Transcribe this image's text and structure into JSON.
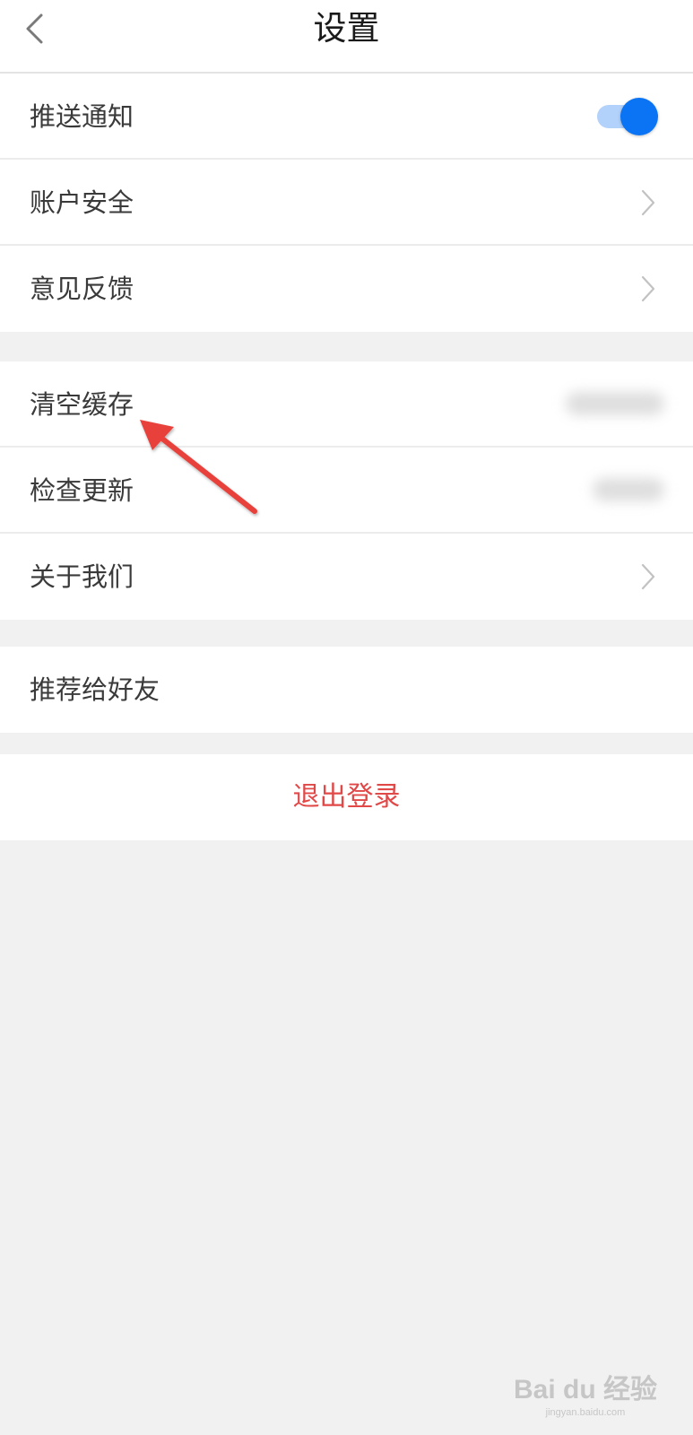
{
  "header": {
    "title": "设置",
    "back_icon": "chevron-left-icon"
  },
  "groups": [
    {
      "items": [
        {
          "label": "推送通知",
          "control": "toggle",
          "toggle_on": true
        },
        {
          "label": "账户安全",
          "control": "chevron"
        },
        {
          "label": "意见反馈",
          "control": "chevron"
        }
      ]
    },
    {
      "items": [
        {
          "label": "清空缓存",
          "control": "blurred-value"
        },
        {
          "label": "检查更新",
          "control": "blurred-value"
        },
        {
          "label": "关于我们",
          "control": "chevron"
        }
      ]
    },
    {
      "items": [
        {
          "label": "推荐给好友",
          "control": "none"
        }
      ]
    }
  ],
  "logout": {
    "label": "退出登录"
  },
  "watermark": {
    "main": "Bai du 经验",
    "sub": "jingyan.baidu.com"
  },
  "colors": {
    "accent": "#0a74f4",
    "accent_light": "#b3d2fb",
    "danger": "#e14848",
    "background": "#f1f1f1",
    "annotation": "#e8403a"
  }
}
